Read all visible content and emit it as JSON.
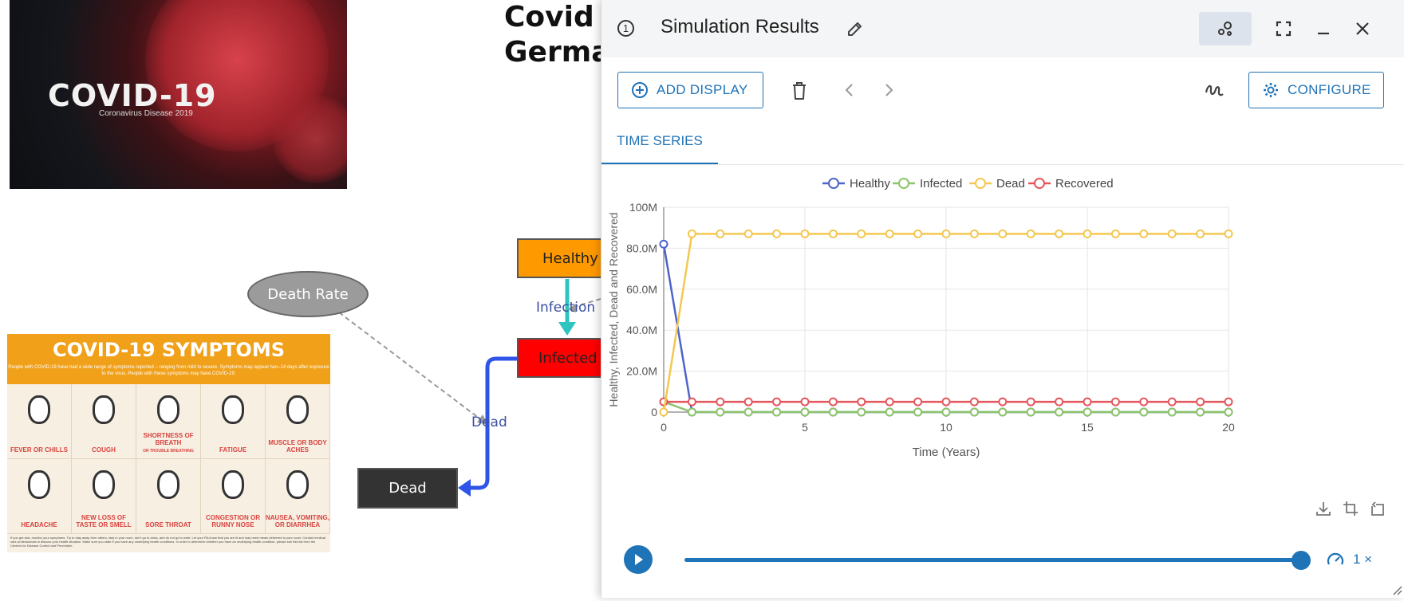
{
  "model": {
    "title_line1": "Covid",
    "title_line2": "German",
    "banner_title": "COVID-19",
    "banner_subtitle": "Coronavirus Disease 2019",
    "death_rate_label": "Death Rate",
    "stock_healthy": "Healthy",
    "stock_infected": "Infected",
    "stock_dead": "Dead",
    "flow_infection": "Infection",
    "flow_dead": "Dead",
    "colors": {
      "healthy_stock": "#ff9900",
      "infected_stock": "#ff0000",
      "dead_stock": "#333333",
      "infection_arrow": "#2ec4c0",
      "dead_arrow": "#2f55e8"
    }
  },
  "symptoms_poster": {
    "title": "COVID-19 SYMPTOMS",
    "subtitle": "People with COVID-19 have had a wide range of symptoms reported – ranging from mild to severe. Symptoms may appear two–14 days after exposure to the virus. People with these symptoms may have COVID-19:",
    "items": [
      {
        "label": "FEVER OR CHILLS"
      },
      {
        "label": "COUGH"
      },
      {
        "label": "SHORTNESS OF BREATH",
        "sub": "OR TROUBLE BREATHING"
      },
      {
        "label": "FATIGUE"
      },
      {
        "label": "MUSCLE OR BODY ACHES"
      },
      {
        "label": "HEADACHE"
      },
      {
        "label": "NEW LOSS OF TASTE OR SMELL"
      },
      {
        "label": "SORE THROAT"
      },
      {
        "label": "CONGESTION OR RUNNY NOSE"
      },
      {
        "label": "NAUSEA, VOMITING, OR DIARRHEA"
      }
    ],
    "footer": "If you get sick, monitor your symptoms. Try to stay away from others, stay in your room, don't go to class, and do not go to work. Let your RA know that you are ill and may need meals delivered to your room. Contact medical care professionals to discuss your health situation. Make sure you state if you have any underlying health conditions. In order to determine whether you have an underlying health condition, please see this list from the Centers for Disease Control and Prevention."
  },
  "panel": {
    "info_icon": "info-icon",
    "title": "Simulation Results",
    "header_icons": [
      "edit-icon",
      "share-icon",
      "fullscreen-icon",
      "minimize-icon",
      "close-icon"
    ],
    "add_display_label": "ADD DISPLAY",
    "configure_label": "CONFIGURE",
    "tab_label": "TIME SERIES",
    "speed_label": "1 ×",
    "playback_progress": 1.0,
    "accent": "#1f73b7"
  },
  "chart_data": {
    "type": "line",
    "xlabel": "Time (Years)",
    "ylabel": "Healthy, Infected, Dead and Recovered",
    "xlim": [
      0,
      20
    ],
    "ylim": [
      0,
      100000000
    ],
    "xticks": [
      0,
      5,
      10,
      15,
      20
    ],
    "yticks": [
      0,
      20000000,
      40000000,
      60000000,
      80000000,
      100000000
    ],
    "ytick_labels": [
      "0",
      "20.0M",
      "40.0M",
      "60.0M",
      "80.0M",
      "100M"
    ],
    "grid": true,
    "legend": "top-center",
    "x": [
      0,
      1,
      2,
      3,
      4,
      5,
      6,
      7,
      8,
      9,
      10,
      11,
      12,
      13,
      14,
      15,
      16,
      17,
      18,
      19,
      20
    ],
    "series": [
      {
        "name": "Healthy",
        "color": "#4e64c9",
        "values": [
          82000000,
          0,
          0,
          0,
          0,
          0,
          0,
          0,
          0,
          0,
          0,
          0,
          0,
          0,
          0,
          0,
          0,
          0,
          0,
          0,
          0
        ]
      },
      {
        "name": "Infected",
        "color": "#8cc56a",
        "values": [
          5000000,
          0,
          0,
          0,
          0,
          0,
          0,
          0,
          0,
          0,
          0,
          0,
          0,
          0,
          0,
          0,
          0,
          0,
          0,
          0,
          0
        ]
      },
      {
        "name": "Dead",
        "color": "#f4c74f",
        "values": [
          0,
          87000000,
          87000000,
          87000000,
          87000000,
          87000000,
          87000000,
          87000000,
          87000000,
          87000000,
          87000000,
          87000000,
          87000000,
          87000000,
          87000000,
          87000000,
          87000000,
          87000000,
          87000000,
          87000000,
          87000000
        ]
      },
      {
        "name": "Recovered",
        "color": "#e4555c",
        "values": [
          5000000,
          5000000,
          5000000,
          5000000,
          5000000,
          5000000,
          5000000,
          5000000,
          5000000,
          5000000,
          5000000,
          5000000,
          5000000,
          5000000,
          5000000,
          5000000,
          5000000,
          5000000,
          5000000,
          5000000,
          5000000
        ]
      }
    ]
  }
}
